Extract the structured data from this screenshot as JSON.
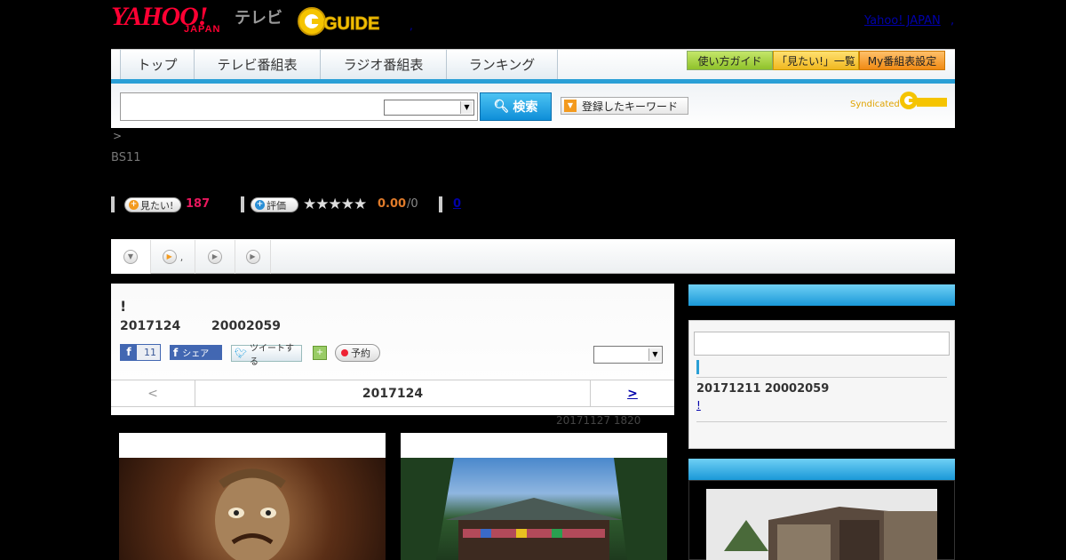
{
  "header": {
    "logo_text": "YAHOO!",
    "logo_sub": "JAPAN",
    "tv_label": "テレビ",
    "gguide_label": "GUIDE",
    "yahoo_japan_link": "Yahoo! JAPAN",
    "link_dot": ",",
    "header_dot": ","
  },
  "nav": {
    "tabs": [
      {
        "label": "トップ"
      },
      {
        "label": "テレビ番組表"
      },
      {
        "label": "ラジオ番組表"
      },
      {
        "label": "ランキング"
      }
    ],
    "buttons": [
      {
        "label": "使い方ガイド",
        "color": "#9ccd3c"
      },
      {
        "label": "「見たい!」一覧",
        "color": "#f5c22c"
      },
      {
        "label": "My番組表設定",
        "color": "#f39a1e"
      }
    ]
  },
  "search": {
    "input_value": "",
    "select_value": "",
    "button_label": "検索",
    "keyword_button": "登録したキーワード",
    "syndicated": "Syndicated"
  },
  "breadcrumb": ">",
  "channel": "BS11",
  "stats": {
    "want_label": "見たい!",
    "want_count": "187",
    "rate_label": "評価",
    "stars": "★★★★★",
    "score": "0.00",
    "score_count": "/0",
    "comments": "0"
  },
  "tabs": {
    "tab2_text": ","
  },
  "program": {
    "title": "!",
    "date": "2017124",
    "time": "20002059",
    "fb_like_count": "11",
    "fb_share": "シェア",
    "tweet": "ツイートする",
    "reserve": "予約",
    "select_value": "",
    "pager_prev": "<",
    "pager_current": "2017124",
    "pager_next": ">",
    "updated": "20171127  1820"
  },
  "sidebar": {
    "next_date": "20171211  20002059",
    "next_link": "!            "
  },
  "colors": {
    "accent": "#2a9fd6",
    "want": "#e8175d",
    "score": "#e07b2a"
  }
}
